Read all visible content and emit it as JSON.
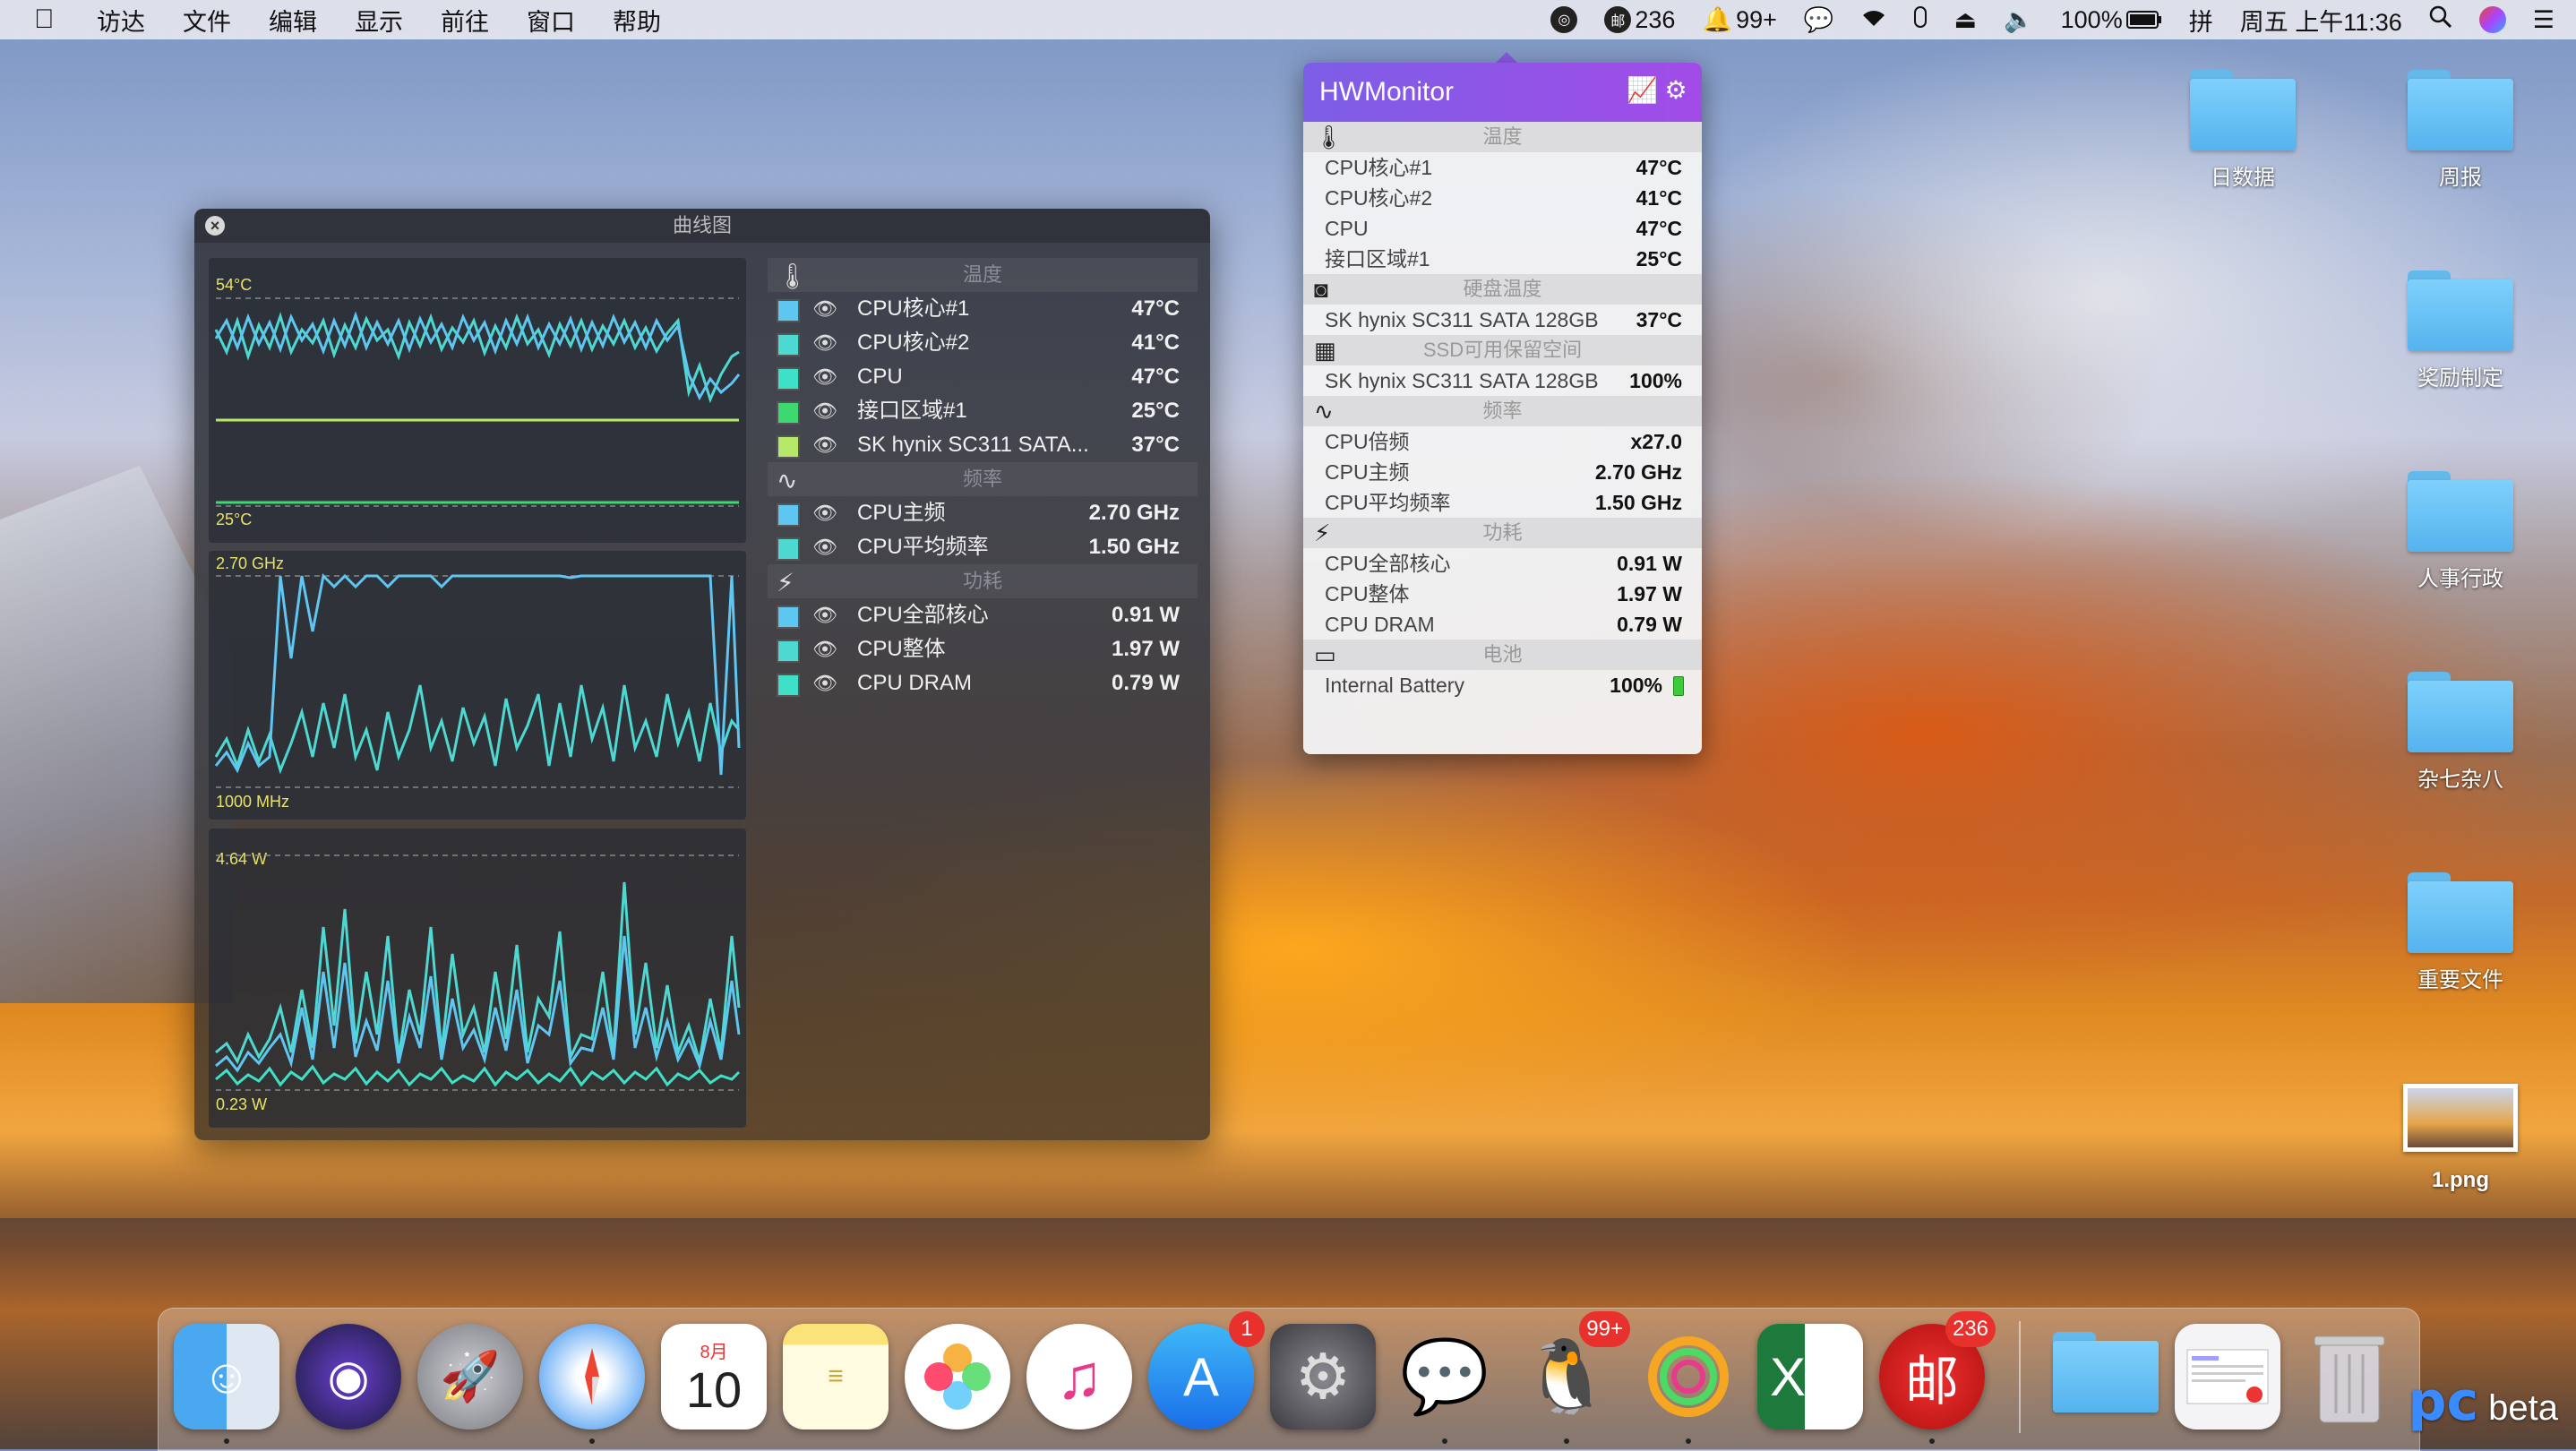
{
  "menubar": {
    "items": [
      "访达",
      "文件",
      "编辑",
      "显示",
      "前往",
      "窗口",
      "帮助"
    ],
    "status": {
      "mail_count": "236",
      "notification_count": "99+",
      "battery": "100%",
      "input_method": "拼",
      "clock": "周五 上午11:36"
    }
  },
  "desktop_icons": [
    {
      "label": "日数据"
    },
    {
      "label": "周报"
    },
    {
      "label": "奖励制定"
    },
    {
      "label": "人事行政"
    },
    {
      "label": "杂七杂八"
    },
    {
      "label": "重要文件"
    },
    {
      "label": "1.png"
    }
  ],
  "curve_window": {
    "title": "曲线图",
    "temp_graph": {
      "max_label": "54°C",
      "min_label": "25°C"
    },
    "freq_graph": {
      "max_label": "2.70 GHz",
      "min_label": "1000 MHz"
    },
    "power_graph": {
      "max_label": "4.64 W",
      "min_label": "0.23 W"
    },
    "sections": [
      {
        "title": "温度",
        "icon": "thermometer-icon",
        "rows": [
          {
            "name": "CPU核心#1",
            "value": "47°C",
            "color": "#5ec6f0"
          },
          {
            "name": "CPU核心#2",
            "value": "41°C",
            "color": "#4dd9d2"
          },
          {
            "name": "CPU",
            "value": "47°C",
            "color": "#3ee0c8"
          },
          {
            "name": "接口区域#1",
            "value": "25°C",
            "color": "#3ed870"
          },
          {
            "name": "SK hynix SC311 SATA...",
            "value": "37°C",
            "color": "#b6e86a"
          }
        ]
      },
      {
        "title": "频率",
        "icon": "frequency-icon",
        "rows": [
          {
            "name": "CPU主频",
            "value": "2.70 GHz",
            "color": "#5ec6f0"
          },
          {
            "name": "CPU平均频率",
            "value": "1.50 GHz",
            "color": "#4dd9d2"
          }
        ]
      },
      {
        "title": "功耗",
        "icon": "lightning-icon",
        "rows": [
          {
            "name": "CPU全部核心",
            "value": "0.91 W",
            "color": "#5ec6f0"
          },
          {
            "name": "CPU整体",
            "value": "1.97 W",
            "color": "#4dd9d2"
          },
          {
            "name": "CPU DRAM",
            "value": "0.79 W",
            "color": "#3ee0c8"
          }
        ]
      }
    ]
  },
  "hwmonitor": {
    "title": "HWMonitor",
    "sections": [
      {
        "title": "温度",
        "icon": "thermometer-icon",
        "rows": [
          {
            "name": "CPU核心#1",
            "value": "47°C"
          },
          {
            "name": "CPU核心#2",
            "value": "41°C"
          },
          {
            "name": "CPU",
            "value": "47°C"
          },
          {
            "name": "接口区域#1",
            "value": "25°C"
          }
        ]
      },
      {
        "title": "硬盘温度",
        "icon": "disk-icon",
        "rows": [
          {
            "name": "SK hynix SC311 SATA 128GB",
            "value": "37°C"
          }
        ]
      },
      {
        "title": "SSD可用保留空间",
        "icon": "ssd-icon",
        "rows": [
          {
            "name": "SK hynix SC311 SATA 128GB",
            "value": "100%"
          }
        ]
      },
      {
        "title": "频率",
        "icon": "frequency-icon",
        "rows": [
          {
            "name": "CPU倍频",
            "value": "x27.0"
          },
          {
            "name": "CPU主频",
            "value": "2.70 GHz"
          },
          {
            "name": "CPU平均频率",
            "value": "1.50 GHz"
          }
        ]
      },
      {
        "title": "功耗",
        "icon": "lightning-icon",
        "rows": [
          {
            "name": "CPU全部核心",
            "value": "0.91 W"
          },
          {
            "name": "CPU整体",
            "value": "1.97 W"
          },
          {
            "name": "CPU DRAM",
            "value": "0.79 W"
          }
        ]
      },
      {
        "title": "电池",
        "icon": "battery-icon",
        "rows": [
          {
            "name": "Internal Battery",
            "value": "100%"
          }
        ]
      }
    ]
  },
  "dock": {
    "calendar_month": "8月",
    "calendar_day": "10",
    "app_store_badge": "1",
    "qq_badge": "99+",
    "mail_badge": "236",
    "excel_letter": "X"
  },
  "watermark": {
    "brand": "pc",
    "text": "beta"
  }
}
